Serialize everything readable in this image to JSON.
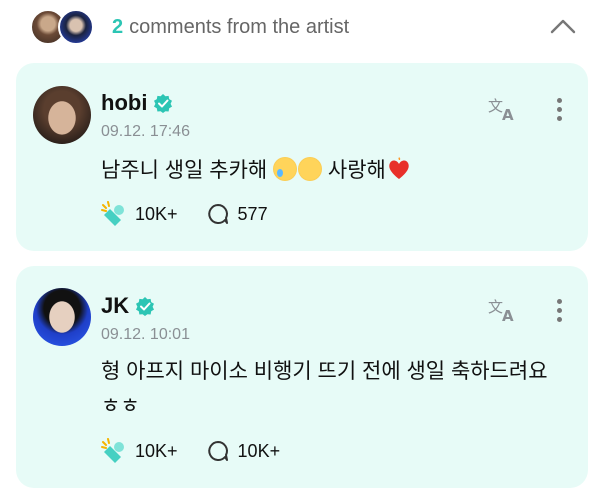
{
  "header": {
    "count": "2",
    "label": "comments from the artist"
  },
  "comments": [
    {
      "author": "hobi",
      "time": "09.12. 17:46",
      "text_before": "남주니 생일 추카해 ",
      "text_after": " 사랑해",
      "likes": "10K+",
      "replies": "577"
    },
    {
      "author": "JK",
      "time": "09.12. 10:01",
      "text": "형 아프지 마이소 비행기 뜨기 전에 생일 축하드려요 ㅎㅎ",
      "likes": "10K+",
      "replies": "10K+"
    }
  ],
  "colors": {
    "accent": "#2cc5b4",
    "card_bg": "#e7fbf7",
    "verified": "#2cc5b4"
  },
  "icons": [
    "chevron-up-icon",
    "verified-icon",
    "translate-icon",
    "more-icon",
    "cheer-icon",
    "comment-icon"
  ]
}
